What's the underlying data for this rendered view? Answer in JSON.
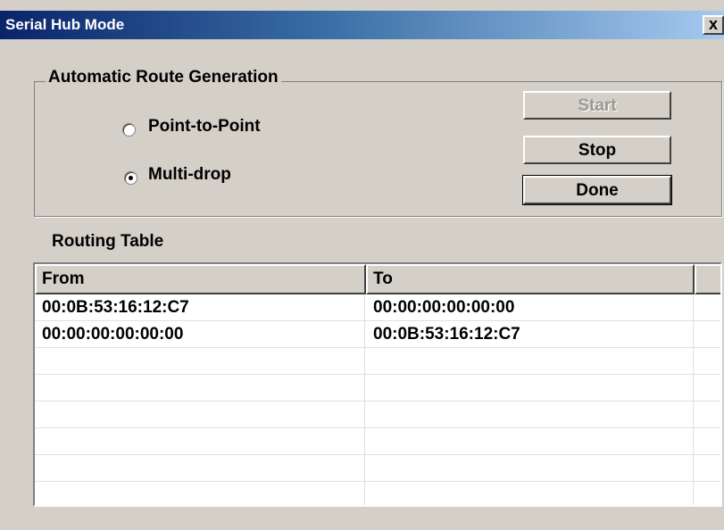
{
  "window": {
    "title": "Serial Hub Mode",
    "close_label": "x"
  },
  "route_generation": {
    "title": "Automatic Route Generation",
    "options": [
      {
        "label": "Point-to-Point",
        "selected": false
      },
      {
        "label": "Multi-drop",
        "selected": true
      }
    ]
  },
  "buttons": {
    "start": {
      "label": "Start",
      "enabled": false
    },
    "stop": {
      "label": "Stop",
      "enabled": true
    },
    "done": {
      "label": "Done",
      "enabled": true,
      "default": true
    }
  },
  "routing_table": {
    "label": "Routing Table",
    "columns": [
      "From",
      "To"
    ],
    "rows": [
      {
        "from": "00:0B:53:16:12:C7",
        "to": "00:00:00:00:00:00"
      },
      {
        "from": "00:00:00:00:00:00",
        "to": "00:0B:53:16:12:C7"
      }
    ]
  }
}
